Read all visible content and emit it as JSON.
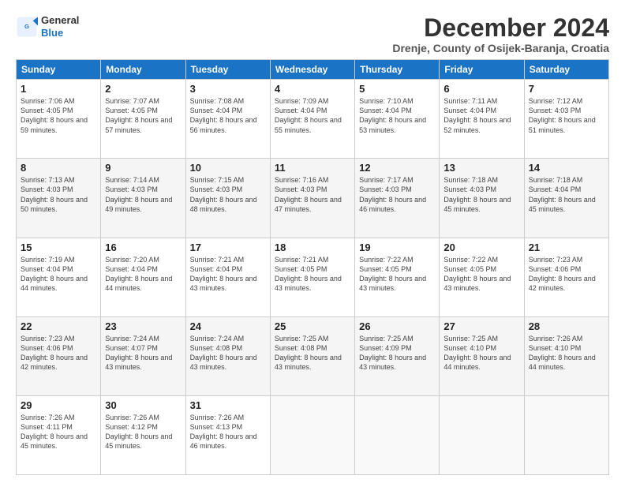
{
  "header": {
    "logo_line1": "General",
    "logo_line2": "Blue",
    "month": "December 2024",
    "location": "Drenje, County of Osijek-Baranja, Croatia"
  },
  "weekdays": [
    "Sunday",
    "Monday",
    "Tuesday",
    "Wednesday",
    "Thursday",
    "Friday",
    "Saturday"
  ],
  "weeks": [
    [
      {
        "day": "1",
        "info": "Sunrise: 7:06 AM\nSunset: 4:05 PM\nDaylight: 8 hours\nand 59 minutes."
      },
      {
        "day": "2",
        "info": "Sunrise: 7:07 AM\nSunset: 4:05 PM\nDaylight: 8 hours\nand 57 minutes."
      },
      {
        "day": "3",
        "info": "Sunrise: 7:08 AM\nSunset: 4:04 PM\nDaylight: 8 hours\nand 56 minutes."
      },
      {
        "day": "4",
        "info": "Sunrise: 7:09 AM\nSunset: 4:04 PM\nDaylight: 8 hours\nand 55 minutes."
      },
      {
        "day": "5",
        "info": "Sunrise: 7:10 AM\nSunset: 4:04 PM\nDaylight: 8 hours\nand 53 minutes."
      },
      {
        "day": "6",
        "info": "Sunrise: 7:11 AM\nSunset: 4:04 PM\nDaylight: 8 hours\nand 52 minutes."
      },
      {
        "day": "7",
        "info": "Sunrise: 7:12 AM\nSunset: 4:03 PM\nDaylight: 8 hours\nand 51 minutes."
      }
    ],
    [
      {
        "day": "8",
        "info": "Sunrise: 7:13 AM\nSunset: 4:03 PM\nDaylight: 8 hours\nand 50 minutes."
      },
      {
        "day": "9",
        "info": "Sunrise: 7:14 AM\nSunset: 4:03 PM\nDaylight: 8 hours\nand 49 minutes."
      },
      {
        "day": "10",
        "info": "Sunrise: 7:15 AM\nSunset: 4:03 PM\nDaylight: 8 hours\nand 48 minutes."
      },
      {
        "day": "11",
        "info": "Sunrise: 7:16 AM\nSunset: 4:03 PM\nDaylight: 8 hours\nand 47 minutes."
      },
      {
        "day": "12",
        "info": "Sunrise: 7:17 AM\nSunset: 4:03 PM\nDaylight: 8 hours\nand 46 minutes."
      },
      {
        "day": "13",
        "info": "Sunrise: 7:18 AM\nSunset: 4:03 PM\nDaylight: 8 hours\nand 45 minutes."
      },
      {
        "day": "14",
        "info": "Sunrise: 7:18 AM\nSunset: 4:04 PM\nDaylight: 8 hours\nand 45 minutes."
      }
    ],
    [
      {
        "day": "15",
        "info": "Sunrise: 7:19 AM\nSunset: 4:04 PM\nDaylight: 8 hours\nand 44 minutes."
      },
      {
        "day": "16",
        "info": "Sunrise: 7:20 AM\nSunset: 4:04 PM\nDaylight: 8 hours\nand 44 minutes."
      },
      {
        "day": "17",
        "info": "Sunrise: 7:21 AM\nSunset: 4:04 PM\nDaylight: 8 hours\nand 43 minutes."
      },
      {
        "day": "18",
        "info": "Sunrise: 7:21 AM\nSunset: 4:05 PM\nDaylight: 8 hours\nand 43 minutes."
      },
      {
        "day": "19",
        "info": "Sunrise: 7:22 AM\nSunset: 4:05 PM\nDaylight: 8 hours\nand 43 minutes."
      },
      {
        "day": "20",
        "info": "Sunrise: 7:22 AM\nSunset: 4:05 PM\nDaylight: 8 hours\nand 43 minutes."
      },
      {
        "day": "21",
        "info": "Sunrise: 7:23 AM\nSunset: 4:06 PM\nDaylight: 8 hours\nand 42 minutes."
      }
    ],
    [
      {
        "day": "22",
        "info": "Sunrise: 7:23 AM\nSunset: 4:06 PM\nDaylight: 8 hours\nand 42 minutes."
      },
      {
        "day": "23",
        "info": "Sunrise: 7:24 AM\nSunset: 4:07 PM\nDaylight: 8 hours\nand 43 minutes."
      },
      {
        "day": "24",
        "info": "Sunrise: 7:24 AM\nSunset: 4:08 PM\nDaylight: 8 hours\nand 43 minutes."
      },
      {
        "day": "25",
        "info": "Sunrise: 7:25 AM\nSunset: 4:08 PM\nDaylight: 8 hours\nand 43 minutes."
      },
      {
        "day": "26",
        "info": "Sunrise: 7:25 AM\nSunset: 4:09 PM\nDaylight: 8 hours\nand 43 minutes."
      },
      {
        "day": "27",
        "info": "Sunrise: 7:25 AM\nSunset: 4:10 PM\nDaylight: 8 hours\nand 44 minutes."
      },
      {
        "day": "28",
        "info": "Sunrise: 7:26 AM\nSunset: 4:10 PM\nDaylight: 8 hours\nand 44 minutes."
      }
    ],
    [
      {
        "day": "29",
        "info": "Sunrise: 7:26 AM\nSunset: 4:11 PM\nDaylight: 8 hours\nand 45 minutes."
      },
      {
        "day": "30",
        "info": "Sunrise: 7:26 AM\nSunset: 4:12 PM\nDaylight: 8 hours\nand 45 minutes."
      },
      {
        "day": "31",
        "info": "Sunrise: 7:26 AM\nSunset: 4:13 PM\nDaylight: 8 hours\nand 46 minutes."
      },
      {
        "day": "",
        "info": ""
      },
      {
        "day": "",
        "info": ""
      },
      {
        "day": "",
        "info": ""
      },
      {
        "day": "",
        "info": ""
      }
    ]
  ]
}
